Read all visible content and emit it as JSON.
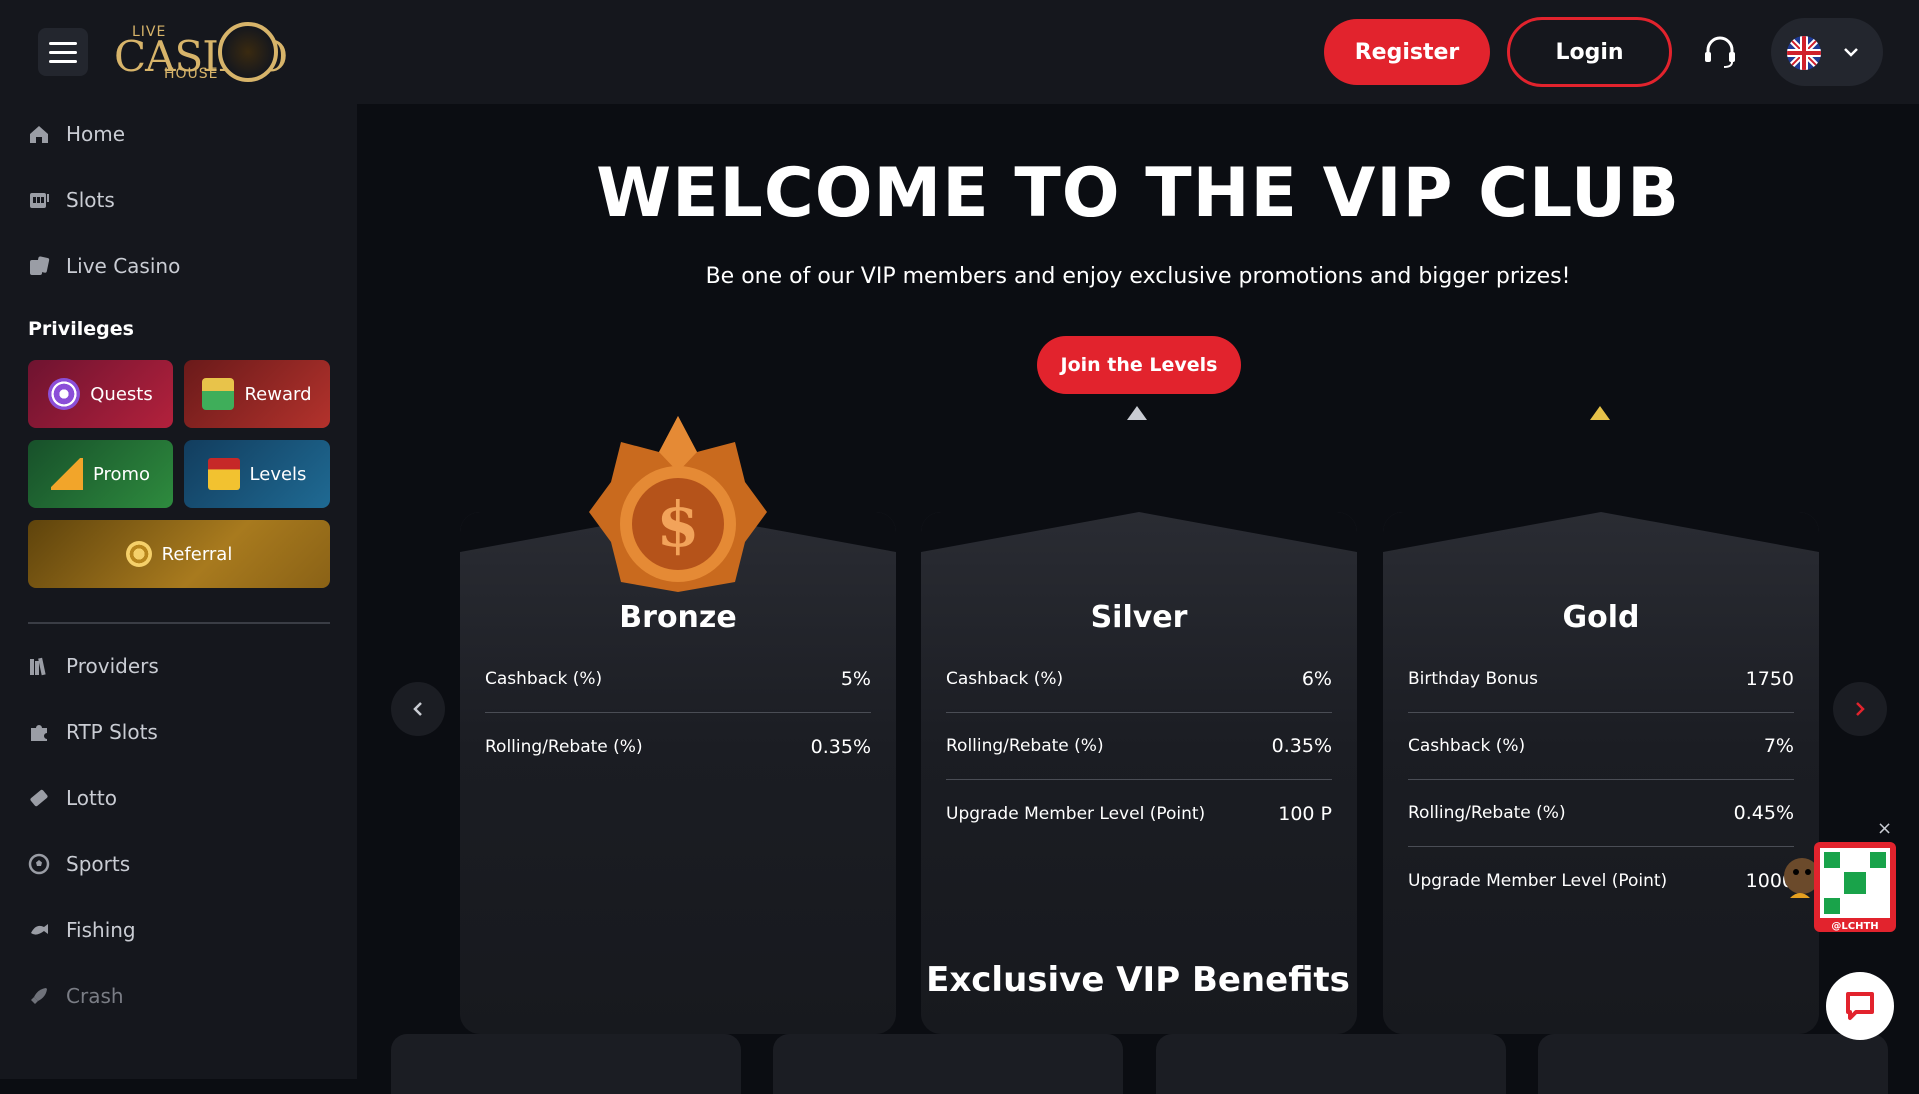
{
  "header": {
    "logo_top": "LIVE",
    "logo_main": "CASINO",
    "logo_bottom": "HOUSE",
    "register_label": "Register",
    "login_label": "Login",
    "language": "English"
  },
  "sidebar": {
    "items_top": [
      {
        "label": "Home",
        "icon": "home-icon"
      },
      {
        "label": "Slots",
        "icon": "slots-icon"
      },
      {
        "label": "Live Casino",
        "icon": "live-casino-icon"
      }
    ],
    "privileges_title": "Privileges",
    "privileges": [
      {
        "label": "Quests",
        "icon": "target-icon"
      },
      {
        "label": "Reward",
        "icon": "gift-icon"
      },
      {
        "label": "Promo",
        "icon": "party-icon"
      },
      {
        "label": "Levels",
        "icon": "crown-icon"
      },
      {
        "label": "Referral",
        "icon": "gear-coin-icon"
      }
    ],
    "items_bottom": [
      {
        "label": "Providers",
        "icon": "providers-icon"
      },
      {
        "label": "RTP Slots",
        "icon": "puzzle-icon"
      },
      {
        "label": "Lotto",
        "icon": "ticket-icon"
      },
      {
        "label": "Sports",
        "icon": "soccer-ball-icon"
      },
      {
        "label": "Fishing",
        "icon": "fishing-icon"
      },
      {
        "label": "Crash",
        "icon": "rocket-icon"
      }
    ]
  },
  "main": {
    "title": "WELCOME TO THE VIP CLUB",
    "subtitle": "Be one of our VIP members and enjoy exclusive promotions and bigger prizes!",
    "join_label": "Join the Levels",
    "tiers": [
      {
        "name": "Bronze",
        "rows": [
          {
            "label": "Cashback (%)",
            "value": "5%"
          },
          {
            "label": "Rolling/Rebate (%)",
            "value": "0.35%"
          }
        ]
      },
      {
        "name": "Silver",
        "rows": [
          {
            "label": "Cashback (%)",
            "value": "6%"
          },
          {
            "label": "Rolling/Rebate (%)",
            "value": "0.35%"
          },
          {
            "label": "Upgrade Member Level (Point)",
            "value": "100 P"
          }
        ]
      },
      {
        "name": "Gold",
        "rows": [
          {
            "label": "Birthday Bonus",
            "value": "1750"
          },
          {
            "label": "Cashback (%)",
            "value": "7%"
          },
          {
            "label": "Rolling/Rebate (%)",
            "value": "0.45%"
          },
          {
            "label": "Upgrade Member Level (Point)",
            "value": "1000"
          }
        ]
      }
    ],
    "benefits_title": "Exclusive VIP Benefits"
  },
  "widgets": {
    "line_handle": "@LCHTH",
    "close_glyph": "×"
  },
  "colors": {
    "accent_red": "#e2232d",
    "bg_dark": "#0b0d12",
    "panel": "#15171d",
    "gold": "#d7b46a"
  }
}
